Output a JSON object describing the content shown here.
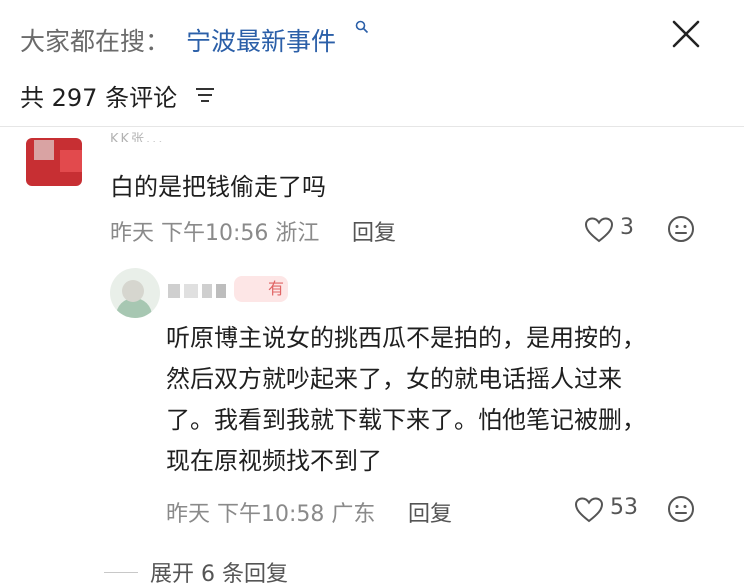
{
  "header": {
    "search_prefix": "大家都在搜：",
    "search_term": "宁波最新事件",
    "search_icon": "search-icon",
    "close_icon": "close-icon"
  },
  "comments_header": {
    "count_text": "共 297 条评论",
    "sort_icon": "sort-icon"
  },
  "comments": [
    {
      "username": "KK张...",
      "text": "白的是把钱偷走了吗",
      "meta": "昨天 下午10:56 浙江",
      "reply_label": "回复",
      "likes": "3"
    },
    {
      "badge": "有",
      "text_lines": [
        "听原博主说女的挑西瓜不是拍的，是用按的，",
        "然后双方就吵起来了，女的就电话摇人过来",
        "了。我看到我就下载下来了。怕他笔记被删，",
        "现在原视频找不到了"
      ],
      "meta": "昨天 下午10:58 广东",
      "reply_label": "回复",
      "likes": "53"
    }
  ],
  "expand_replies": "展开 6 条回复"
}
